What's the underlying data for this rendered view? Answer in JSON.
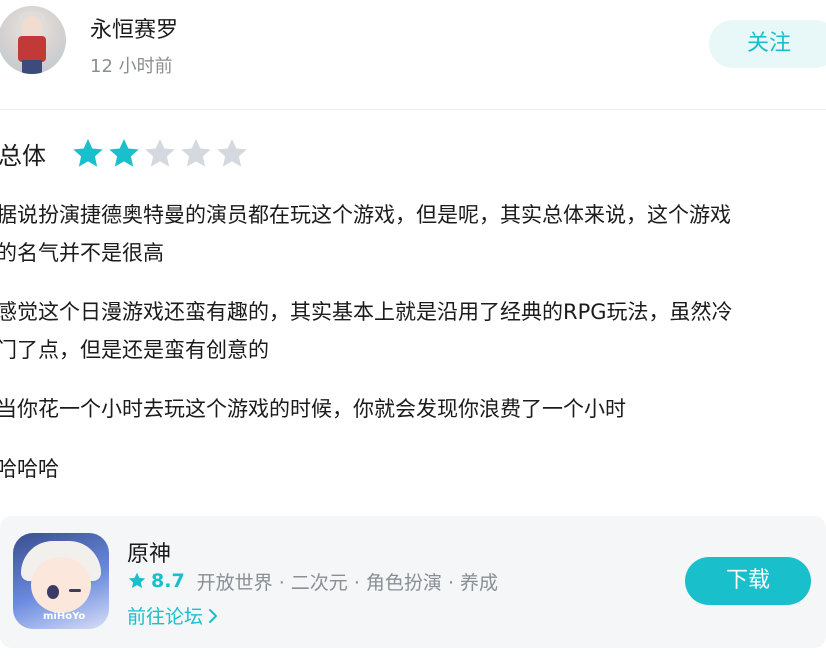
{
  "header": {
    "username": "永恒赛罗",
    "time": "12 小时前",
    "follow_label": "关注"
  },
  "rating": {
    "label": "总体",
    "value": 2,
    "max": 5
  },
  "review": {
    "lines": [
      "据说扮演捷德奥特曼的演员都在玩这个游戏，但是呢，其实总体来说，这个游戏",
      "的名气并不是很高",
      "感觉这个日漫游戏还蛮有趣的，其实基本上就是沿用了经典的RPG玩法，虽然冷",
      "门了点，但是还是蛮有创意的",
      "当你花一个小时去玩这个游戏的时候，你就会发现你浪费了一个小时",
      "哈哈哈"
    ]
  },
  "game": {
    "name": "原神",
    "score": "8.7",
    "tags": "开放世界 · 二次元 · 角色扮演 · 养成",
    "forum_label": "前往论坛",
    "download_label": "下载",
    "icon_brand": "miHoYo"
  },
  "colors": {
    "accent": "#19bfca",
    "star_empty": "#d3d9de",
    "card_bg": "#f4f6f8"
  }
}
